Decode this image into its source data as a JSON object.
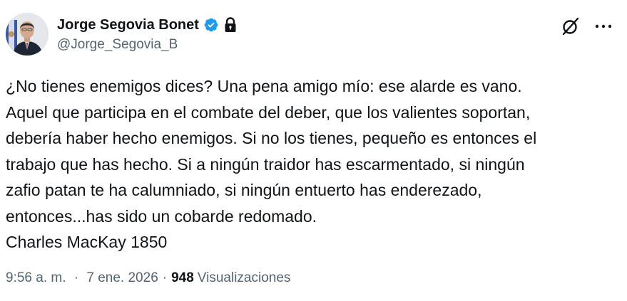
{
  "author": {
    "display_name": "Jorge Segovia Bonet",
    "handle": "@Jorge_Segovia_B",
    "verified": true,
    "protected": true,
    "verified_color": "#1d9bf0"
  },
  "icons": {
    "verified": "verified-badge-icon",
    "lock": "lock-icon",
    "grok": "grok-icon",
    "more": "more-options-icon"
  },
  "tweet": {
    "lines": [
      "¿No tienes enemigos dices? Una pena amigo mío: ese alarde es vano.",
      "Aquel que participa en el combate del deber, que los valientes soportan,",
      "debería haber hecho enemigos. Si no los tienes, pequeño es entonces el",
      "trabajo que has hecho. Si a ningún traidor has escarmentado, si ningún",
      "zafio patan te ha calumniado, si ningún entuerto has enderezado,",
      "entonces...has sido un cobarde redomado.",
      "Charles MacKay 1850"
    ]
  },
  "meta": {
    "time": "9:56 a. m.",
    "separator": "·",
    "date": "7 ene. 2026",
    "views_count": "948",
    "views_label": "Visualizaciones"
  }
}
